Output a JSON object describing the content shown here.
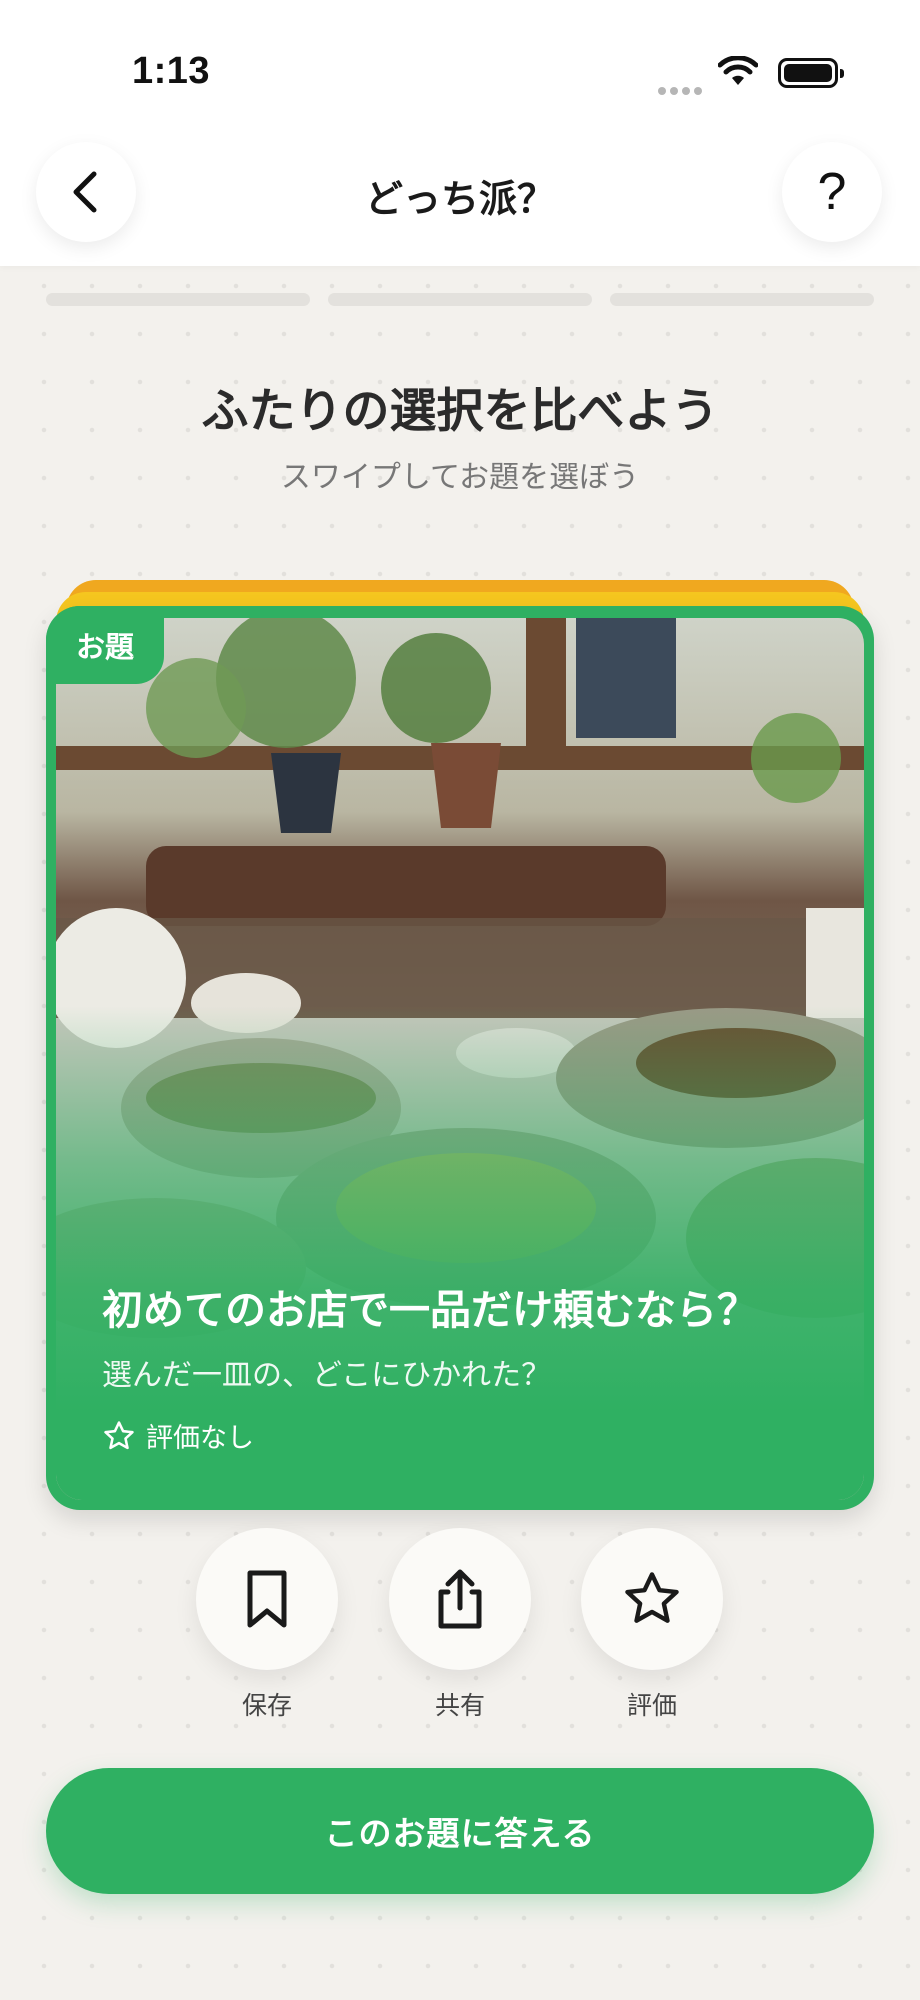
{
  "status_bar": {
    "time": "1:13",
    "icons": [
      "cellular-signal-icon",
      "wifi-icon",
      "battery-icon"
    ]
  },
  "nav": {
    "title": "どっち派？",
    "back_icon": "chevron-left-icon",
    "help_label": "?"
  },
  "progress": {
    "segments": 3
  },
  "intro": {
    "title": "ふたりの選択を比べよう",
    "subtitle": "スワイプしてお題を選ぼう"
  },
  "card": {
    "tag": "お題",
    "title": "初めてのお店で一品だけ頼むなら？",
    "subtitle": "選んだ一皿の、どこにひかれた？",
    "rating_label": "評価なし",
    "image_subject": "table with dishes by a window with plants",
    "stack_colors": [
      "#f0a81f",
      "#f5c61f"
    ]
  },
  "actions": [
    {
      "label": "保存",
      "icon": "bookmark-icon"
    },
    {
      "label": "共有",
      "icon": "share-icon"
    },
    {
      "label": "評価",
      "icon": "star-icon"
    }
  ],
  "cta": {
    "label": "このお題に答える"
  },
  "colors": {
    "accent": "#2fb062",
    "background": "#f3f1ed"
  }
}
